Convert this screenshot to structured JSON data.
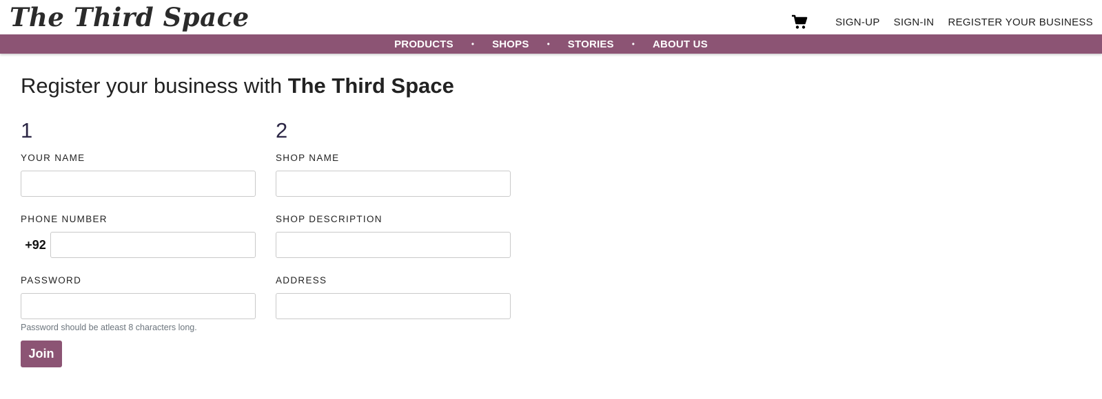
{
  "header": {
    "logo_text": "The Third Space",
    "links": [
      "SIGN-UP",
      "SIGN-IN",
      "REGISTER YOUR BUSINESS"
    ],
    "cart_icon": "shopping-cart-icon"
  },
  "nav": {
    "items": [
      "PRODUCTS",
      "SHOPS",
      "STORIES",
      "ABOUT US"
    ],
    "separator": "•",
    "color": "#8c5474"
  },
  "page": {
    "heading_prefix": "Register your business with",
    "heading_brand": "The Third Space"
  },
  "form": {
    "step1": {
      "number": "1",
      "name_label": "YOUR NAME",
      "name_value": "",
      "phone_label": "PHONE NUMBER",
      "phone_prefix": "+92",
      "phone_value": "",
      "password_label": "PASSWORD",
      "password_value": "",
      "password_hint": "Password should be atleast 8 characters long."
    },
    "step2": {
      "number": "2",
      "shop_name_label": "SHOP NAME",
      "shop_name_value": "",
      "shop_description_label": "SHOP DESCRIPTION",
      "shop_description_value": "",
      "address_label": "ADDRESS",
      "address_value": ""
    },
    "submit_label": "Join",
    "accent": "#8c5474"
  }
}
